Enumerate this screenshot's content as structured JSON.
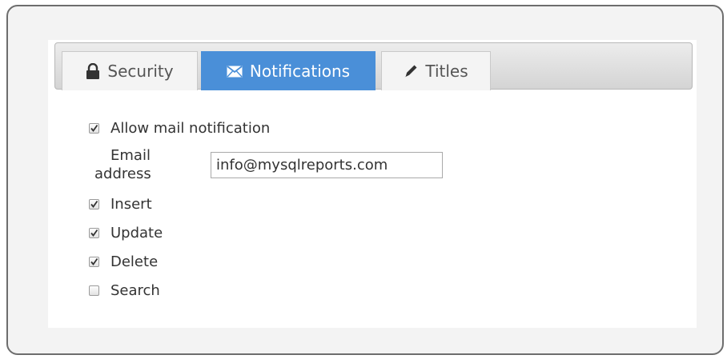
{
  "tabs": [
    {
      "label": "Security",
      "icon": "lock-icon",
      "active": false
    },
    {
      "label": "Notifications",
      "icon": "envelope-icon",
      "active": true
    },
    {
      "label": "Titles",
      "icon": "pencil-icon",
      "active": false
    }
  ],
  "form": {
    "allow_mail": {
      "label": "Allow mail notification",
      "checked": true
    },
    "email": {
      "label_line1": "Email",
      "label_line2": "address",
      "value": "info@mysqlreports.com"
    },
    "options": [
      {
        "label": "Insert",
        "checked": true
      },
      {
        "label": "Update",
        "checked": true
      },
      {
        "label": "Delete",
        "checked": true
      },
      {
        "label": "Search",
        "checked": false
      }
    ]
  },
  "colors": {
    "active_tab": "#4a8fd8",
    "frame_border": "#6d6d6d"
  }
}
